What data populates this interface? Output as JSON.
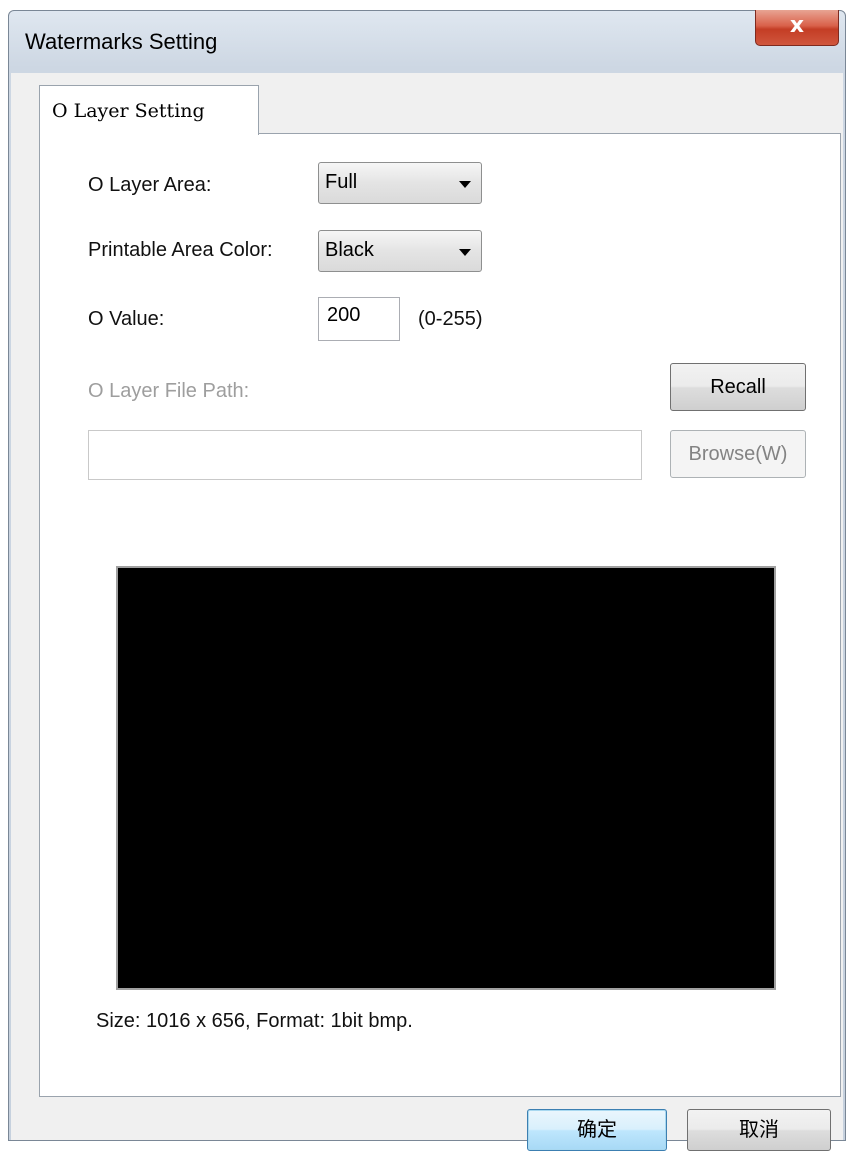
{
  "window": {
    "title": "Watermarks Setting",
    "close_glyph": "x"
  },
  "tab": {
    "label": "O Layer Setting"
  },
  "form": {
    "o_layer_area": {
      "label": "O Layer Area:",
      "value": "Full"
    },
    "printable_area_color": {
      "label": "Printable Area Color:",
      "value": "Black"
    },
    "o_value": {
      "label": "O Value:",
      "value": "200",
      "range": "(0-255)"
    },
    "o_layer_file_path": {
      "label": "O Layer File Path:",
      "value": ""
    },
    "recall_label": "Recall",
    "browse_label": "Browse(W)"
  },
  "preview": {
    "fill_color": "#000000",
    "info": "Size: 1016 x 656, Format: 1bit bmp."
  },
  "footer": {
    "ok_label": "确定",
    "cancel_label": "取消"
  },
  "colors": {
    "close_button": "#c43d25",
    "default_button_border": "#3c7fb1"
  }
}
